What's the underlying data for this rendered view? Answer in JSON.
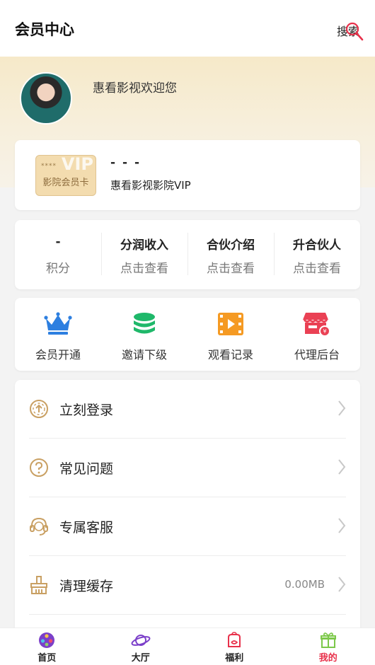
{
  "header": {
    "title": "会员中心",
    "search_label": "搜索"
  },
  "profile": {
    "welcome": "惠看影视欢迎您"
  },
  "vip_card": {
    "badge_stars": "****",
    "badge_vip": "VIP",
    "badge_name": "影院会员卡",
    "level": "- - -",
    "name": "惠看影视影院VIP"
  },
  "stats": [
    {
      "value": "-",
      "label": "积分"
    },
    {
      "value": "分润收入",
      "label": "点击查看"
    },
    {
      "value": "合伙介绍",
      "label": "点击查看"
    },
    {
      "value": "升合伙人",
      "label": "点击查看"
    }
  ],
  "quick_actions": [
    {
      "label": "会员开通",
      "icon": "crown-icon",
      "color": "#2d7fe0"
    },
    {
      "label": "邀请下级",
      "icon": "coins-stack-icon",
      "color": "#1fb86a"
    },
    {
      "label": "观看记录",
      "icon": "film-play-icon",
      "color": "#f59a23"
    },
    {
      "label": "代理后台",
      "icon": "store-icon",
      "color": "#ea4154"
    }
  ],
  "menu": [
    {
      "label": "立刻登录",
      "icon": "login-arrow-icon",
      "value": ""
    },
    {
      "label": "常见问题",
      "icon": "question-icon",
      "value": ""
    },
    {
      "label": "专属客服",
      "icon": "headset-icon",
      "value": ""
    },
    {
      "label": "清理缓存",
      "icon": "broom-icon",
      "value": "0.00MB"
    }
  ],
  "tabs": [
    {
      "label": "首页",
      "icon": "film-reel-icon",
      "active": false
    },
    {
      "label": "大厅",
      "icon": "planet-icon",
      "active": false
    },
    {
      "label": "福利",
      "icon": "gift-bag-icon",
      "active": false
    },
    {
      "label": "我的",
      "icon": "gift-box-icon",
      "active": true
    }
  ],
  "colors": {
    "accent_gold": "#c9a063",
    "active_tab": "#e8314b"
  }
}
